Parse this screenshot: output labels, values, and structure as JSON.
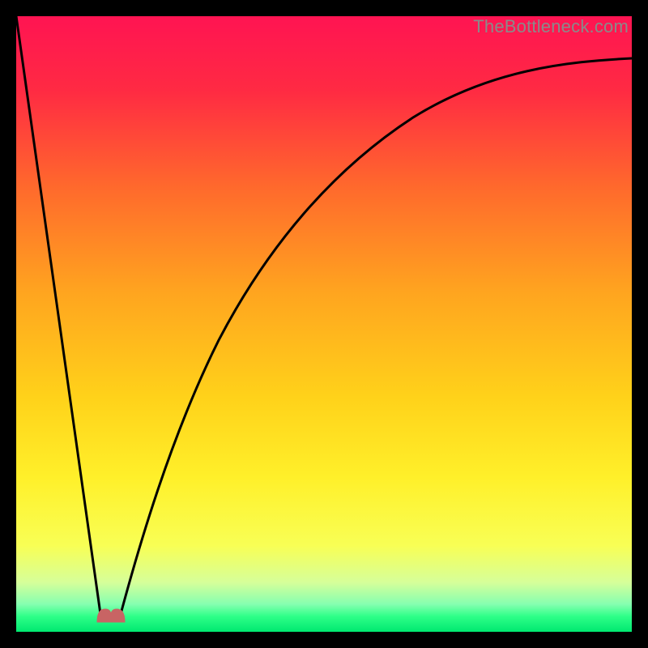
{
  "watermark": "TheBottleneck.com",
  "chart_data": {
    "type": "line",
    "title": "",
    "xlabel": "",
    "ylabel": "",
    "xlim": [
      0,
      100
    ],
    "ylim": [
      0,
      100
    ],
    "grid": false,
    "legend": false,
    "series": [
      {
        "name": "left-branch",
        "x": [
          0,
          2,
          4,
          6,
          8,
          10,
          12,
          13.5
        ],
        "values": [
          100,
          85,
          70,
          56,
          42,
          28,
          14,
          3
        ]
      },
      {
        "name": "right-branch",
        "x": [
          17,
          18,
          20,
          23,
          26,
          30,
          35,
          40,
          46,
          53,
          60,
          68,
          76,
          84,
          92,
          100
        ],
        "values": [
          3,
          7,
          16,
          27,
          37,
          47,
          56,
          63,
          70,
          76,
          80,
          84,
          87,
          89.5,
          91.5,
          93
        ]
      }
    ],
    "marker": {
      "name": "optimal-point",
      "x": 15,
      "y": 2,
      "shape": "rounded-bump",
      "color": "#c86464"
    },
    "background_gradient": {
      "stops": [
        {
          "pos": 0.0,
          "color": "#ff1452"
        },
        {
          "pos": 0.12,
          "color": "#ff2a43"
        },
        {
          "pos": 0.28,
          "color": "#ff6a2c"
        },
        {
          "pos": 0.45,
          "color": "#ffa51f"
        },
        {
          "pos": 0.62,
          "color": "#ffd21a"
        },
        {
          "pos": 0.75,
          "color": "#fff02a"
        },
        {
          "pos": 0.86,
          "color": "#f8ff55"
        },
        {
          "pos": 0.92,
          "color": "#d6ff9a"
        },
        {
          "pos": 0.955,
          "color": "#86ffb0"
        },
        {
          "pos": 0.975,
          "color": "#2eff88"
        },
        {
          "pos": 1.0,
          "color": "#00e870"
        }
      ]
    }
  }
}
